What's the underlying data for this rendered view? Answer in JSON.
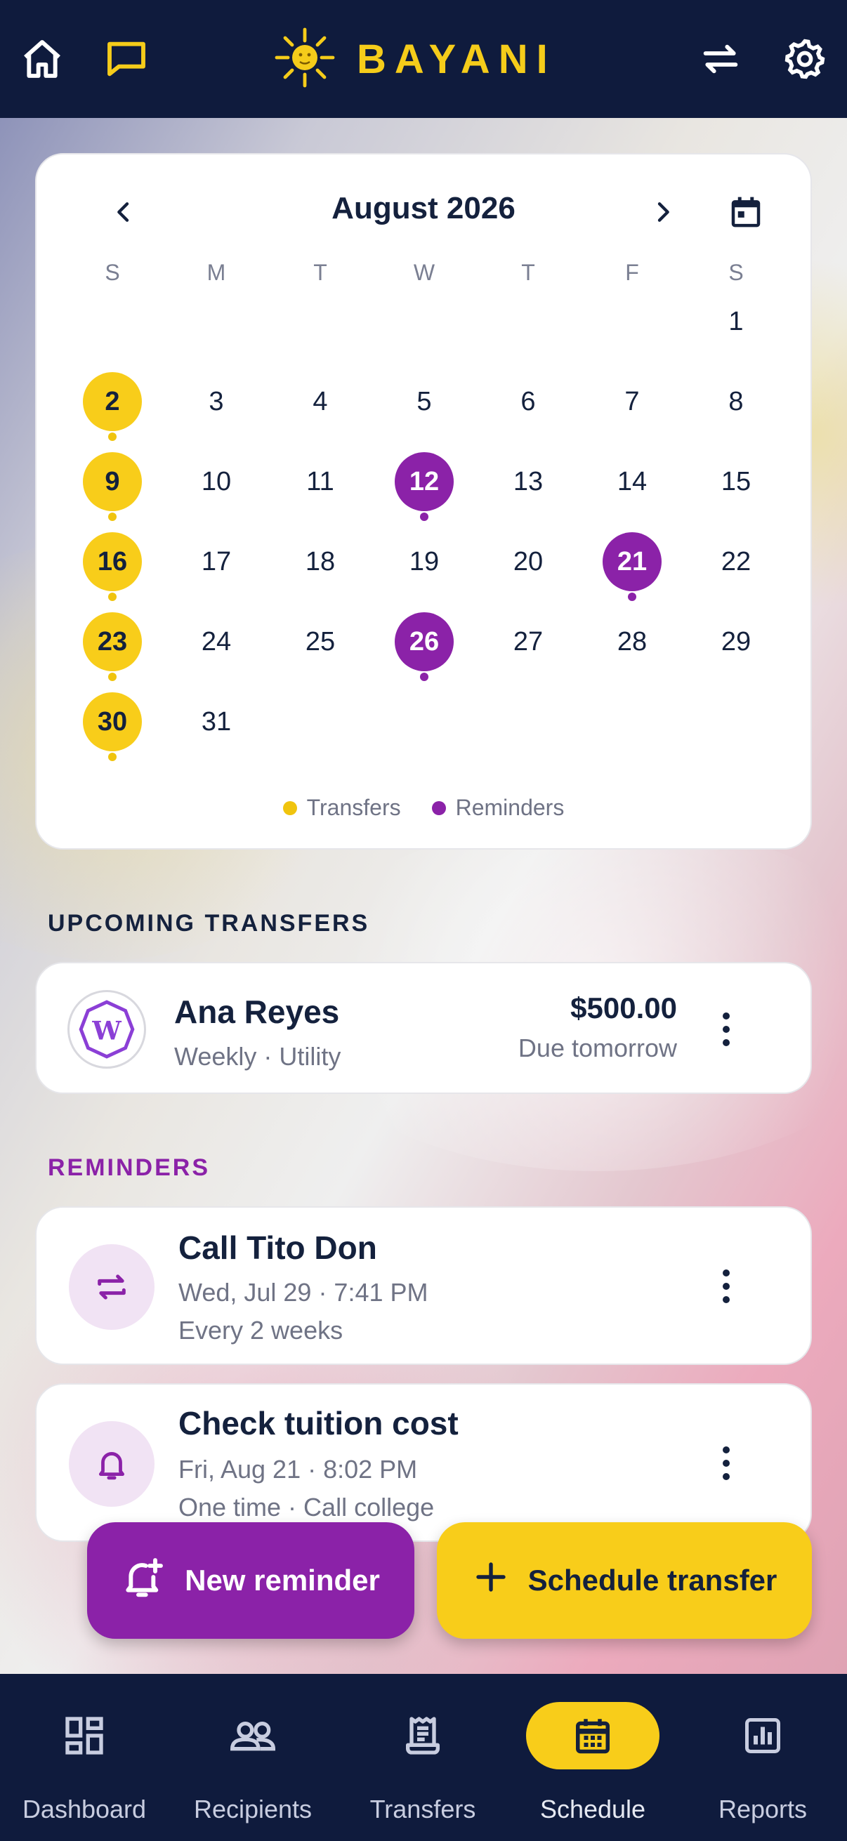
{
  "app": {
    "brand": "BAYANI"
  },
  "colors": {
    "navy": "#0f1b3d",
    "gold": "#f8cd1a",
    "purple": "#8b22a8"
  },
  "topbar": {
    "icons": [
      "home-icon",
      "chat-icon",
      "swap-icon",
      "settings-icon"
    ]
  },
  "calendar": {
    "title": "August 2026",
    "weekdays": [
      "S",
      "M",
      "T",
      "W",
      "T",
      "F",
      "S"
    ],
    "first_weekday_index": 6,
    "days_in_month": 31,
    "transfer_days": [
      2,
      9,
      16,
      23,
      30
    ],
    "reminder_days": [
      12,
      21,
      26
    ],
    "legend": {
      "transfers": "Transfers",
      "reminders": "Reminders"
    }
  },
  "upcoming": {
    "title": "UPCOMING TRANSFERS",
    "items": [
      {
        "name": "Ana Reyes",
        "sub": "Weekly · Utility",
        "amount": "$500.00",
        "due": "Due tomorrow",
        "avatar_letter": "W"
      }
    ]
  },
  "reminders": {
    "title": "REMINDERS",
    "items": [
      {
        "title": "Call Tito Don",
        "when": "Wed, Jul 29 · 7:41 PM",
        "repeat": "Every 2 weeks",
        "icon": "repeat-icon"
      },
      {
        "title": "Check tuition cost",
        "when": "Fri, Aug 21 · 8:02 PM",
        "repeat": "One time · Call college",
        "icon": "bell-icon"
      }
    ]
  },
  "actions": {
    "new_reminder": "New reminder",
    "schedule_transfer": "Schedule transfer"
  },
  "bottom_nav": {
    "items": [
      {
        "label": "Dashboard",
        "icon": "dashboard-icon"
      },
      {
        "label": "Recipients",
        "icon": "people-icon"
      },
      {
        "label": "Transfers",
        "icon": "receipt-icon"
      },
      {
        "label": "Schedule",
        "icon": "calendar-icon",
        "active": true
      },
      {
        "label": "Reports",
        "icon": "chart-icon"
      }
    ]
  }
}
